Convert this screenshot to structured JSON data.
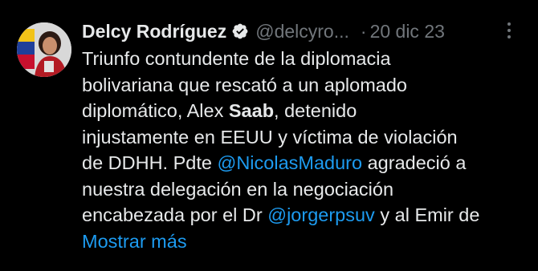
{
  "tweet": {
    "author": {
      "display_name": "Delcy Rodríguez",
      "handle": "@delcyro...",
      "verified_icon": "verified-badge-icon",
      "avatar_icon": "avatar"
    },
    "separator": "·",
    "date": "20 dic 23",
    "more_icon": "more-options-icon",
    "text": {
      "line1": "Triunfo contundente de la diplomacia",
      "line2": "bolivariana que rescató a un aplomado",
      "line3_a": "diplomático, Alex ",
      "line3_bold": "Saab",
      "line3_b": ", detenido",
      "line4": "injustamente en EEUU y víctima de violación",
      "line5_a": "de DDHH. Pdte ",
      "line5_mention": "@NicolasMaduro",
      "line5_b": " agradeció a",
      "line6": "nuestra delegación en la negociación",
      "line7_a": "encabezada por el Dr ",
      "line7_mention": "@jorgerpsuv",
      "line7_b": " y al Emir de"
    },
    "show_more_label": "Mostrar más"
  },
  "colors": {
    "background": "#000000",
    "text": "#e7e9ea",
    "secondary": "#71767b",
    "link": "#1d9bf0"
  }
}
